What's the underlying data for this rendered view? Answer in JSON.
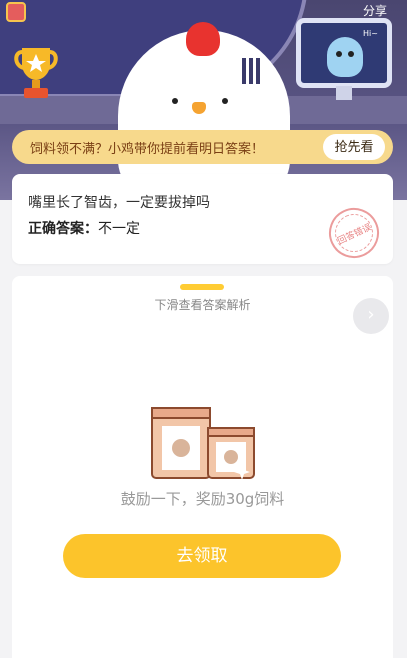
{
  "header": {
    "share_label": "分享",
    "monitor_greeting": "Hi~"
  },
  "banner": {
    "text": "饲料领不满？小鸡带你提前看明日答案！",
    "button_label": "抢先看"
  },
  "question_card": {
    "question": "嘴里长了智齿，一定要拔掉吗",
    "answer_label": "正确答案：",
    "answer_value": "不一定",
    "stamp_text": "回答错误"
  },
  "answer_card": {
    "hint": "下滑查看答案解析",
    "encourage_text": "鼓励一下，奖励30g饲料",
    "claim_button_label": "去领取"
  },
  "icons": {
    "next": "chevron-right-icon",
    "trophy": "trophy-icon",
    "feed_bags": "feed-bag-icon"
  },
  "colors": {
    "accent": "#fcc42b",
    "banner_bg": "#f7d98c",
    "stamp": "#e05a5a"
  }
}
